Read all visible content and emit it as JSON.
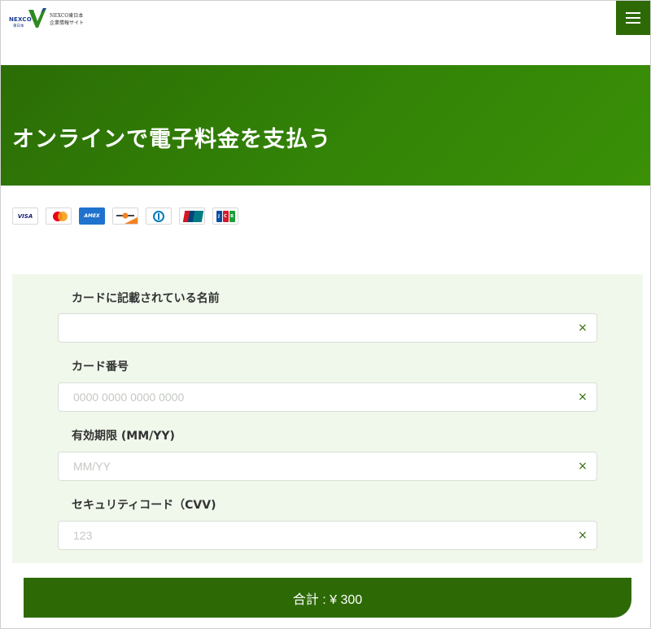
{
  "header": {
    "logo_brand": "NEXCO",
    "logo_region": "東日本",
    "logo_line1": "NEXCO東日本",
    "logo_line2": "企業情報サイト",
    "menu_icon": "hamburger-menu-icon"
  },
  "hero": {
    "title": "オンラインで電子料金を支払う"
  },
  "payment_brands": [
    {
      "name": "VISA",
      "icon": "visa-logo-icon"
    },
    {
      "name": "Mastercard",
      "icon": "mastercard-logo-icon"
    },
    {
      "name": "AMEX",
      "icon": "amex-logo-icon"
    },
    {
      "name": "Discover",
      "icon": "discover-logo-icon"
    },
    {
      "name": "Diners Club",
      "icon": "diners-logo-icon"
    },
    {
      "name": "UnionPay",
      "icon": "unionpay-logo-icon"
    },
    {
      "name": "JCB",
      "icon": "jcb-logo-icon"
    }
  ],
  "form": {
    "name": {
      "label": "カードに記載されている名前",
      "value": "",
      "placeholder": ""
    },
    "card_number": {
      "label": "カード番号",
      "value": "",
      "placeholder": "0000 0000 0000 0000"
    },
    "expiry": {
      "label": "有効期限 (MM/YY)",
      "value": "",
      "placeholder": "MM/YY"
    },
    "cvv": {
      "label": "セキュリティコード（CVV)",
      "value": "",
      "placeholder": "123"
    },
    "clear_glyph": "×"
  },
  "total_button": {
    "label": "合計 : ¥ 300"
  },
  "colors": {
    "brand_green": "#2d6a06",
    "hero_gradient_start": "#2b6d05",
    "hero_gradient_end": "#3a9007",
    "form_background": "#f0f8ec"
  }
}
